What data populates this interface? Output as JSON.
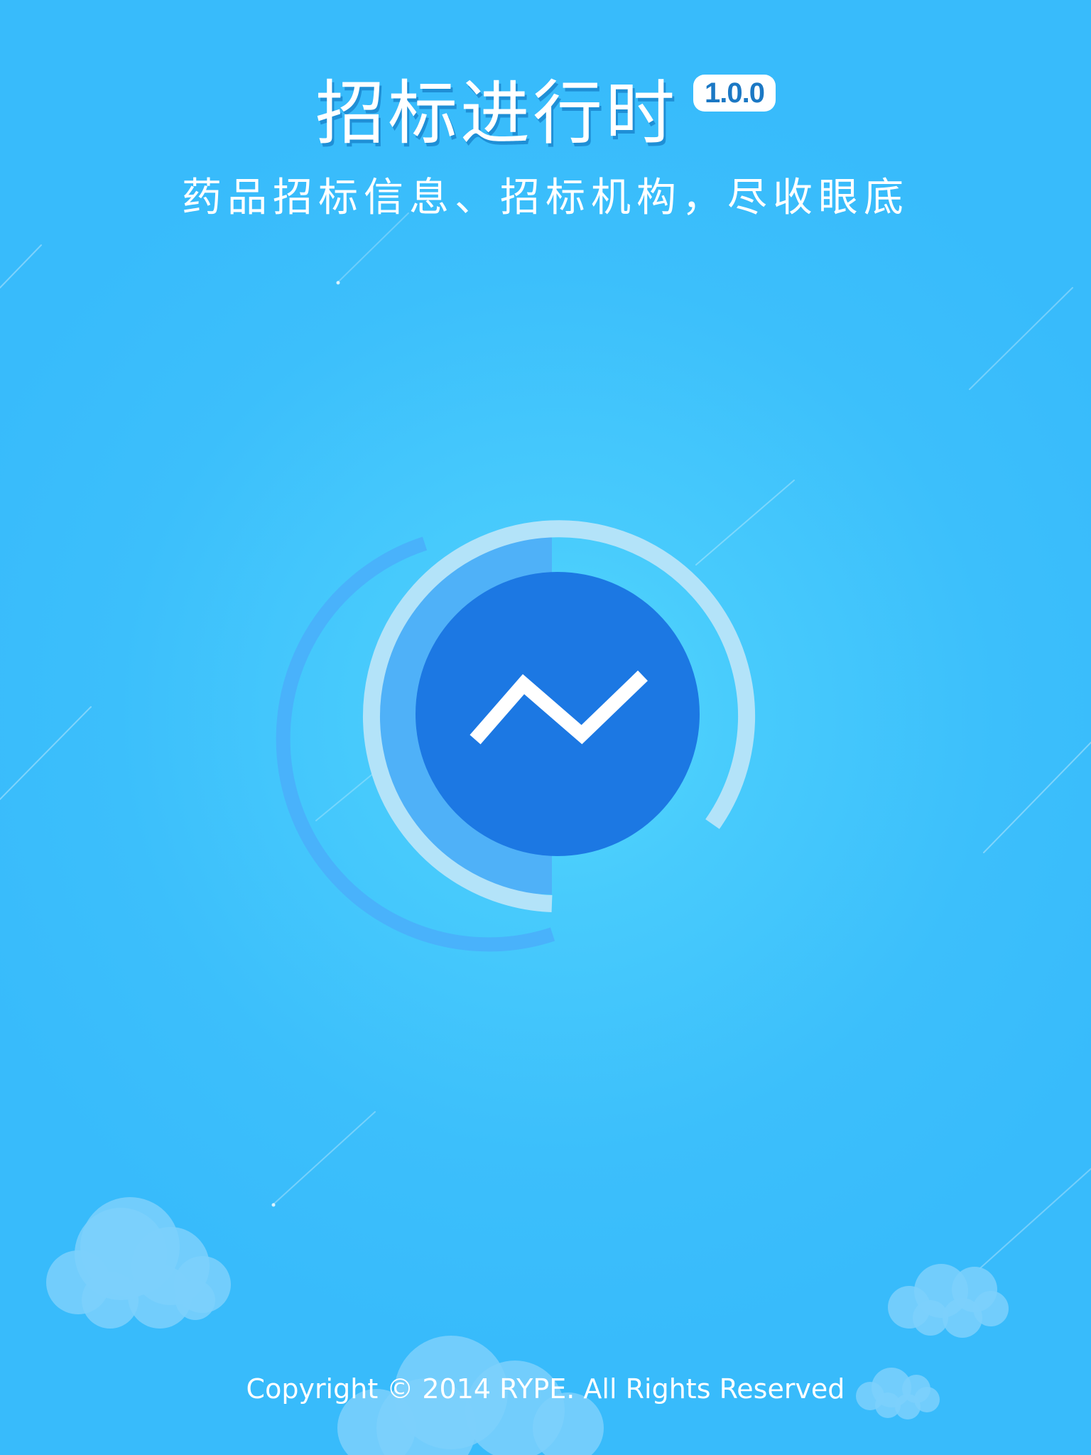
{
  "colors": {
    "background": "#38bbfb",
    "glow": "#55d8fd",
    "logo_core": "#1c78e3",
    "inner_half_disc": "#4fb1f8",
    "ring_light": "#b3e3f9",
    "outer_arc": "#49b2fb",
    "cloud": "#7dd0fc",
    "text": "#ffffff"
  },
  "header": {
    "title": "招标进行时",
    "version": "1.0.0",
    "tagline": "药品招标信息、招标机构，尽收眼底"
  },
  "logo": {
    "icon": "trend-line-icon"
  },
  "footer": {
    "copyright": "Copyright © 2014 RYPE. All Rights Reserved"
  }
}
